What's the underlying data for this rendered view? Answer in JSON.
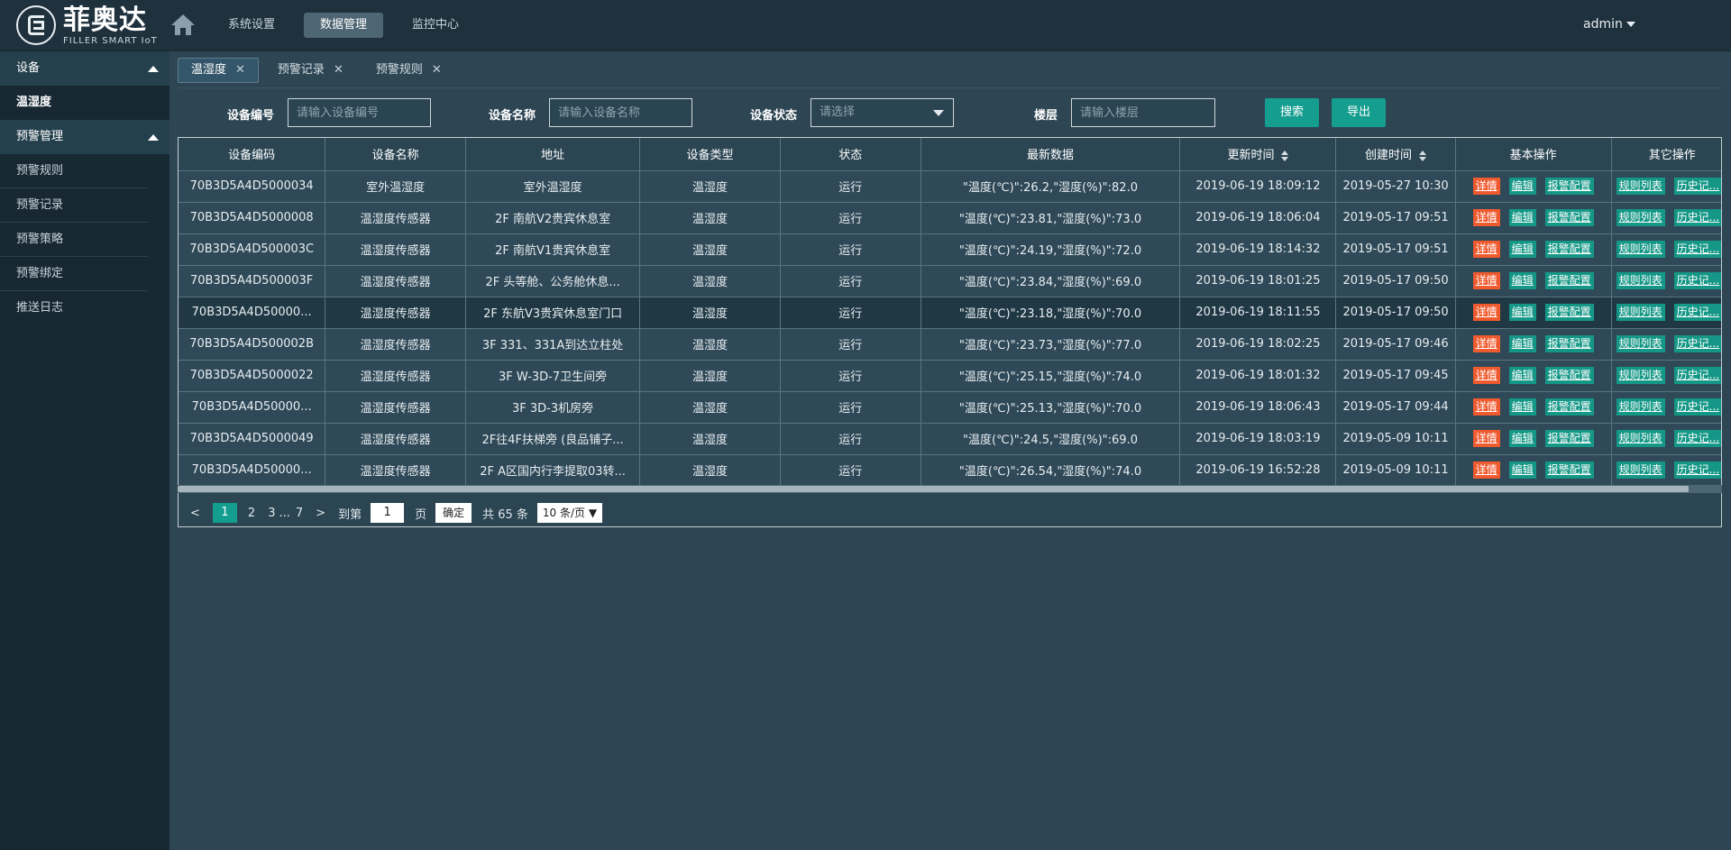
{
  "app": {
    "logo_cn": "菲奥达",
    "logo_en": "FILLER SMART IoT",
    "nav": [
      "系统设置",
      "数据管理",
      "监控中心"
    ],
    "nav_active": 1,
    "user": "admin"
  },
  "sidebar": {
    "group1": "设备",
    "group1_items": [
      "温湿度"
    ],
    "group2": "预警管理",
    "group2_items": [
      "预警规则",
      "预警记录",
      "预警策略",
      "预警绑定",
      "推送日志"
    ]
  },
  "tabs": [
    "温湿度",
    "预警记录",
    "预警规则"
  ],
  "filters": {
    "code_label": "设备编号",
    "code_placeholder": "请输入设备编号",
    "name_label": "设备名称",
    "name_placeholder": "请输入设备名称",
    "status_label": "设备状态",
    "status_placeholder": "请选择",
    "floor_label": "楼层",
    "floor_placeholder": "请输入楼层",
    "search": "搜索",
    "export": "导出"
  },
  "table": {
    "headers": [
      "设备编码",
      "设备名称",
      "地址",
      "设备类型",
      "状态",
      "最新数据",
      "更新时间",
      "创建时间",
      "基本操作",
      "其它操作"
    ],
    "ops": [
      "详情",
      "编辑",
      "报警配置",
      "规则列表",
      "历史记..."
    ],
    "rows": [
      [
        "70B3D5A4D5000034",
        "室外温湿度",
        "室外温湿度",
        "温湿度",
        "运行",
        "\"温度(℃)\":26.2,\"湿度(%)\":82.0",
        "2019-06-19 18:09:12",
        "2019-05-27 10:30"
      ],
      [
        "70B3D5A4D5000008",
        "温湿度传感器",
        "2F 南航V2贵宾休息室",
        "温湿度",
        "运行",
        "\"温度(℃)\":23.81,\"湿度(%)\":73.0",
        "2019-06-19 18:06:04",
        "2019-05-17 09:51"
      ],
      [
        "70B3D5A4D500003C",
        "温湿度传感器",
        "2F 南航V1贵宾休息室",
        "温湿度",
        "运行",
        "\"温度(℃)\":24.19,\"湿度(%)\":72.0",
        "2019-06-19 18:14:32",
        "2019-05-17 09:51"
      ],
      [
        "70B3D5A4D500003F",
        "温湿度传感器",
        "2F 头等舱、公务舱休息...",
        "温湿度",
        "运行",
        "\"温度(℃)\":23.84,\"湿度(%)\":69.0",
        "2019-06-19 18:01:25",
        "2019-05-17 09:50"
      ],
      [
        "70B3D5A4D50000...",
        "温湿度传感器",
        "2F 东航V3贵宾休息室门口",
        "温湿度",
        "运行",
        "\"温度(℃)\":23.18,\"湿度(%)\":70.0",
        "2019-06-19 18:11:55",
        "2019-05-17 09:50"
      ],
      [
        "70B3D5A4D500002B",
        "温湿度传感器",
        "3F 331、331A到达立柱处",
        "温湿度",
        "运行",
        "\"温度(℃)\":23.73,\"湿度(%)\":77.0",
        "2019-06-19 18:02:25",
        "2019-05-17 09:46"
      ],
      [
        "70B3D5A4D5000022",
        "温湿度传感器",
        "3F W-3D-7卫生间旁",
        "温湿度",
        "运行",
        "\"温度(℃)\":25.15,\"湿度(%)\":74.0",
        "2019-06-19 18:01:32",
        "2019-05-17 09:45"
      ],
      [
        "70B3D5A4D50000...",
        "温湿度传感器",
        "3F 3D-3机房旁",
        "温湿度",
        "运行",
        "\"温度(℃)\":25.13,\"湿度(%)\":70.0",
        "2019-06-19 18:06:43",
        "2019-05-17 09:44"
      ],
      [
        "70B3D5A4D5000049",
        "温湿度传感器",
        "2F往4F扶梯旁 (良品铺子...",
        "温湿度",
        "运行",
        "\"温度(℃)\":24.5,\"湿度(%)\":69.0",
        "2019-06-19 18:03:19",
        "2019-05-09 10:11"
      ],
      [
        "70B3D5A4D50000...",
        "温湿度传感器",
        "2F A区国内行李提取03转...",
        "温湿度",
        "运行",
        "\"温度(℃)\":26.54,\"湿度(%)\":74.0",
        "2019-06-19 16:52:28",
        "2019-05-09 10:11"
      ]
    ]
  },
  "pager": {
    "pages": [
      "1",
      "2",
      "3",
      "...",
      "7"
    ],
    "goto": "到第",
    "goto_value": "1",
    "page_unit": "页",
    "confirm": "确定",
    "total": "共 65 条",
    "size": "10 条/页"
  }
}
